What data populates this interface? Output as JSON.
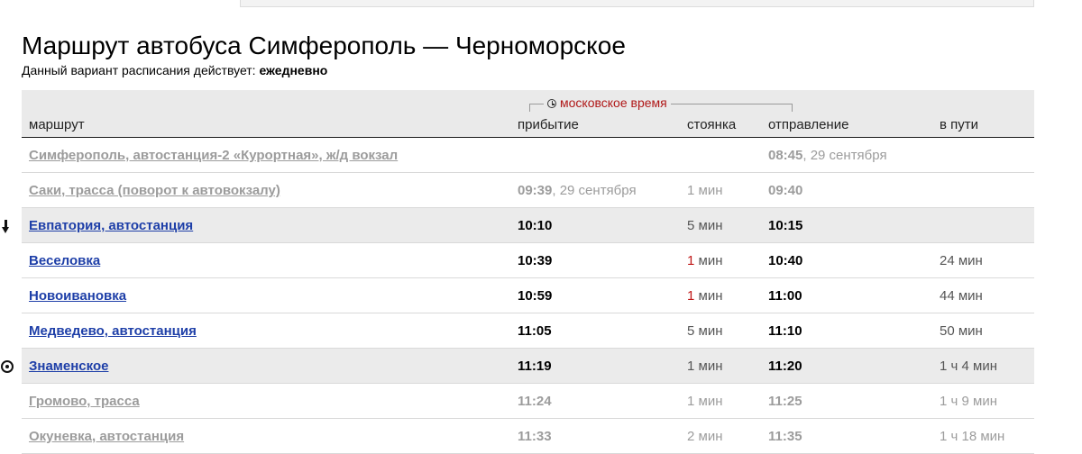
{
  "page": {
    "title": "Маршрут автобуса Симферополь — Черноморское",
    "schedule_label": "Данный вариант расписания действует: ",
    "schedule_value": "ежедневно"
  },
  "table": {
    "timezone_label": "московское время",
    "headers": {
      "route": "маршрут",
      "arrival": "прибытие",
      "stop": "стоянка",
      "departure": "отправление",
      "travel": "в пути"
    },
    "rows": [
      {
        "route": "Симферополь, автостанция-2 «Курортная», ж/д вокзал",
        "arr_time": "",
        "arr_date": "",
        "stop_num": "",
        "stop_unit": "",
        "dep_time": "08:45",
        "dep_date": ", 29 сентября",
        "travel": ""
      },
      {
        "route": "Саки, трасса (поворот к автовокзалу)",
        "arr_time": "09:39",
        "arr_date": ", 29 сентября",
        "stop_num": "1",
        "stop_unit": " мин",
        "dep_time": "09:40",
        "dep_date": "",
        "travel": ""
      },
      {
        "route": "Евпатория, автостанция",
        "arr_time": "10:10",
        "arr_date": "",
        "stop_num": "5",
        "stop_unit": " мин",
        "dep_time": "10:15",
        "dep_date": "",
        "travel": ""
      },
      {
        "route": "Веселовка",
        "arr_time": "10:39",
        "arr_date": "",
        "stop_num": "1",
        "stop_unit": " мин",
        "dep_time": "10:40",
        "dep_date": "",
        "travel": "24 мин"
      },
      {
        "route": "Новоивановка",
        "arr_time": "10:59",
        "arr_date": "",
        "stop_num": "1",
        "stop_unit": " мин",
        "dep_time": "11:00",
        "dep_date": "",
        "travel": "44 мин"
      },
      {
        "route": "Медведево, автостанция",
        "arr_time": "11:05",
        "arr_date": "",
        "stop_num": "5",
        "stop_unit": " мин",
        "dep_time": "11:10",
        "dep_date": "",
        "travel": "50 мин"
      },
      {
        "route": "Знаменское",
        "arr_time": "11:19",
        "arr_date": "",
        "stop_num": "1",
        "stop_unit": " мин",
        "dep_time": "11:20",
        "dep_date": "",
        "travel": "1 ч 4 мин"
      },
      {
        "route": "Громово, трасса",
        "arr_time": "11:24",
        "arr_date": "",
        "stop_num": "1",
        "stop_unit": " мин",
        "dep_time": "11:25",
        "dep_date": "",
        "travel": "1 ч 9 мин"
      },
      {
        "route": "Окуневка, автостанция",
        "arr_time": "11:33",
        "arr_date": "",
        "stop_num": "2",
        "stop_unit": " мин",
        "dep_time": "11:35",
        "dep_date": "",
        "travel": "1 ч 18 мин"
      }
    ]
  },
  "icons": {
    "boarding_marker": "arrow-down-icon",
    "destination_marker": "target-icon"
  },
  "colors": {
    "link": "#1e3fa8",
    "inactive": "#9c9c9c",
    "timezone": "#b01818",
    "stop_highlight": "#c01818"
  }
}
